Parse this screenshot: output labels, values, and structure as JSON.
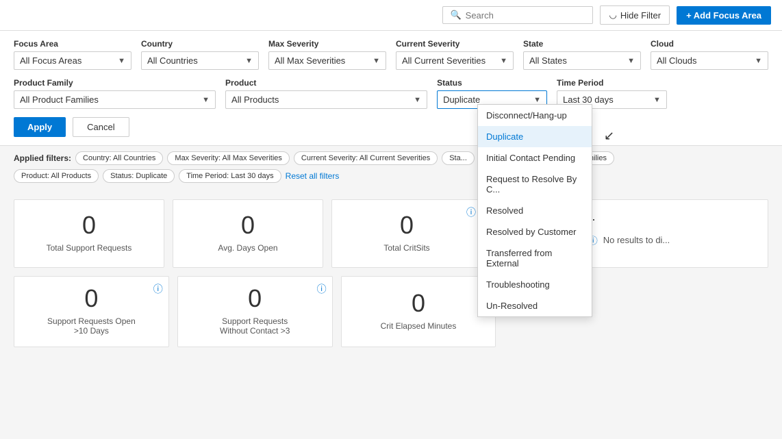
{
  "topbar": {
    "search_placeholder": "Search",
    "hide_filter_label": "Hide Filter",
    "add_focus_label": "+ Add Focus Area"
  },
  "filters": {
    "focus_area": {
      "label": "Focus Area",
      "value": "All Focus Areas"
    },
    "country": {
      "label": "Country",
      "value": "All Countries"
    },
    "max_severity": {
      "label": "Max Severity",
      "value": "All Max Severities"
    },
    "current_severity": {
      "label": "Current Severity",
      "value": "All Current Severities"
    },
    "state": {
      "label": "State",
      "value": "All States"
    },
    "cloud": {
      "label": "Cloud",
      "value": "All Clouds"
    },
    "product_family": {
      "label": "Product Family",
      "value": "All Product Families"
    },
    "product": {
      "label": "Product",
      "value": "All Products"
    },
    "status": {
      "label": "Status",
      "value": "Duplicate"
    },
    "time_period": {
      "label": "Time Period",
      "value": "Last 30 days"
    }
  },
  "buttons": {
    "apply": "Apply",
    "cancel": "Cancel"
  },
  "applied_filters": {
    "label": "Applied filters:",
    "tags": [
      "Country: All Countries",
      "Max Severity: All Max Severities",
      "Current Severity: All Current Severities",
      "Sta...",
      "Product Family: All Product Families",
      "Product: All Products",
      "Status: Duplicate",
      "Time Period: Last 30 Days"
    ],
    "reset_label": "Reset all filters"
  },
  "status_dropdown": {
    "options": [
      "Disconnect/Hang-up",
      "Duplicate",
      "Initial Contact Pending",
      "Request to Resolve By C...",
      "Resolved",
      "Resolved by Customer",
      "Transferred from External",
      "Troubleshooting",
      "Un-Resolved"
    ],
    "selected": "Duplicate"
  },
  "cards_row1": [
    {
      "value": "0",
      "label": "Total Support Requests"
    },
    {
      "value": "0",
      "label": "Avg. Days Open"
    },
    {
      "value": "0",
      "label": "Total CritSits"
    },
    {
      "wide": true,
      "title": "Support Requests D...",
      "no_results": "No results to di..."
    }
  ],
  "cards_row2": [
    {
      "value": "0",
      "label": "Support Requests Open\n>10 Days"
    },
    {
      "value": "0",
      "label": "Support Requests\nWithout Contact >3"
    },
    {
      "value": "0",
      "label": "Crit Elapsed Minutes"
    }
  ]
}
